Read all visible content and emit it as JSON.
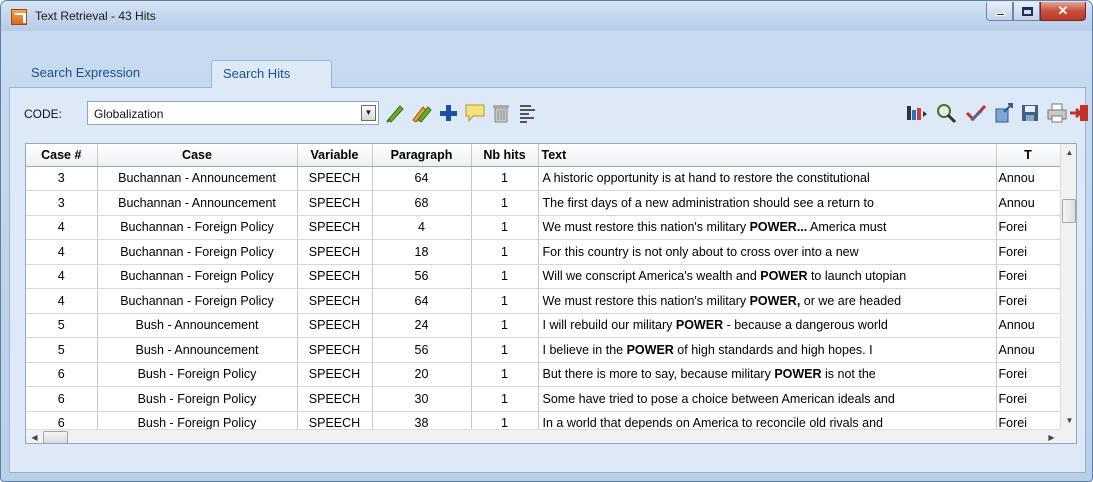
{
  "window": {
    "title": "Text Retrieval - 43 Hits"
  },
  "tabs": [
    {
      "label": "Search Expression",
      "active": false
    },
    {
      "label": "Search Hits",
      "active": true
    }
  ],
  "toolbar": {
    "code_label": "CODE:",
    "code_value": "Globalization",
    "left_icons": [
      "code-green-icon",
      "code-multi-icon",
      "add-icon",
      "comment-icon",
      "delete-icon",
      "text-view-icon"
    ],
    "right_icons": [
      "export-icon",
      "search-zoom-icon",
      "check-icon",
      "send-icon",
      "save-icon",
      "print-icon",
      "exit-icon"
    ]
  },
  "table": {
    "headers": [
      "Case #",
      "Case",
      "Variable",
      "Paragraph",
      "Nb hits",
      "Text",
      "T"
    ],
    "rows": [
      {
        "num": "3",
        "case": "Buchannan - Announcement",
        "variable": "SPEECH",
        "paragraph": "64",
        "hits": "1",
        "text_before": "A historic opportunity is at hand to restore the constitutional",
        "text_bold": "",
        "text_after": "",
        "tail": "Annou"
      },
      {
        "num": "3",
        "case": "Buchannan - Announcement",
        "variable": "SPEECH",
        "paragraph": "68",
        "hits": "1",
        "text_before": "The first days of a new administration should see a return to",
        "text_bold": "",
        "text_after": "",
        "tail": "Annou"
      },
      {
        "num": "4",
        "case": "Buchannan - Foreign Policy",
        "variable": "SPEECH",
        "paragraph": "4",
        "hits": "1",
        "text_before": "We must restore this nation's military ",
        "text_bold": "POWER...",
        "text_after": " America must",
        "tail": "Forei"
      },
      {
        "num": "4",
        "case": "Buchannan - Foreign Policy",
        "variable": "SPEECH",
        "paragraph": "18",
        "hits": "1",
        "text_before": "For this country is not only about to cross over into a new",
        "text_bold": "",
        "text_after": "",
        "tail": "Forei"
      },
      {
        "num": "4",
        "case": "Buchannan - Foreign Policy",
        "variable": "SPEECH",
        "paragraph": "56",
        "hits": "1",
        "text_before": "Will we conscript America's wealth and ",
        "text_bold": "POWER",
        "text_after": " to launch utopian",
        "tail": "Forei"
      },
      {
        "num": "4",
        "case": "Buchannan - Foreign Policy",
        "variable": "SPEECH",
        "paragraph": "64",
        "hits": "1",
        "text_before": "We must restore this nation's military ",
        "text_bold": "POWER,",
        "text_after": " or we are headed",
        "tail": "Forei"
      },
      {
        "num": "5",
        "case": "Bush - Announcement",
        "variable": "SPEECH",
        "paragraph": "24",
        "hits": "1",
        "text_before": "I will rebuild our military ",
        "text_bold": "POWER",
        "text_after": " - because a dangerous world",
        "tail": "Annou"
      },
      {
        "num": "5",
        "case": "Bush - Announcement",
        "variable": "SPEECH",
        "paragraph": "56",
        "hits": "1",
        "text_before": "I believe in the ",
        "text_bold": "POWER",
        "text_after": " of high standards and high hopes. I",
        "tail": "Annou"
      },
      {
        "num": "6",
        "case": "Bush - Foreign Policy",
        "variable": "SPEECH",
        "paragraph": "20",
        "hits": "1",
        "text_before": "But there is more to say, because military ",
        "text_bold": "POWER",
        "text_after": " is not the",
        "tail": "Forei"
      },
      {
        "num": "6",
        "case": "Bush - Foreign Policy",
        "variable": "SPEECH",
        "paragraph": "30",
        "hits": "1",
        "text_before": "Some have tried to pose a choice between American ideals and",
        "text_bold": "",
        "text_after": "",
        "tail": "Forei"
      },
      {
        "num": "6",
        "case": "Bush - Foreign Policy",
        "variable": "SPEECH",
        "paragraph": "38",
        "hits": "1",
        "text_before": "In a world that depends on America to reconcile old rivals and",
        "text_bold": "",
        "text_after": "",
        "tail": "Forei"
      }
    ]
  },
  "colors": {
    "window_frame": "#b9cfe8",
    "panel": "#dde9f6",
    "tab_text": "#1d4f8a",
    "close_button": "#c7513b"
  }
}
